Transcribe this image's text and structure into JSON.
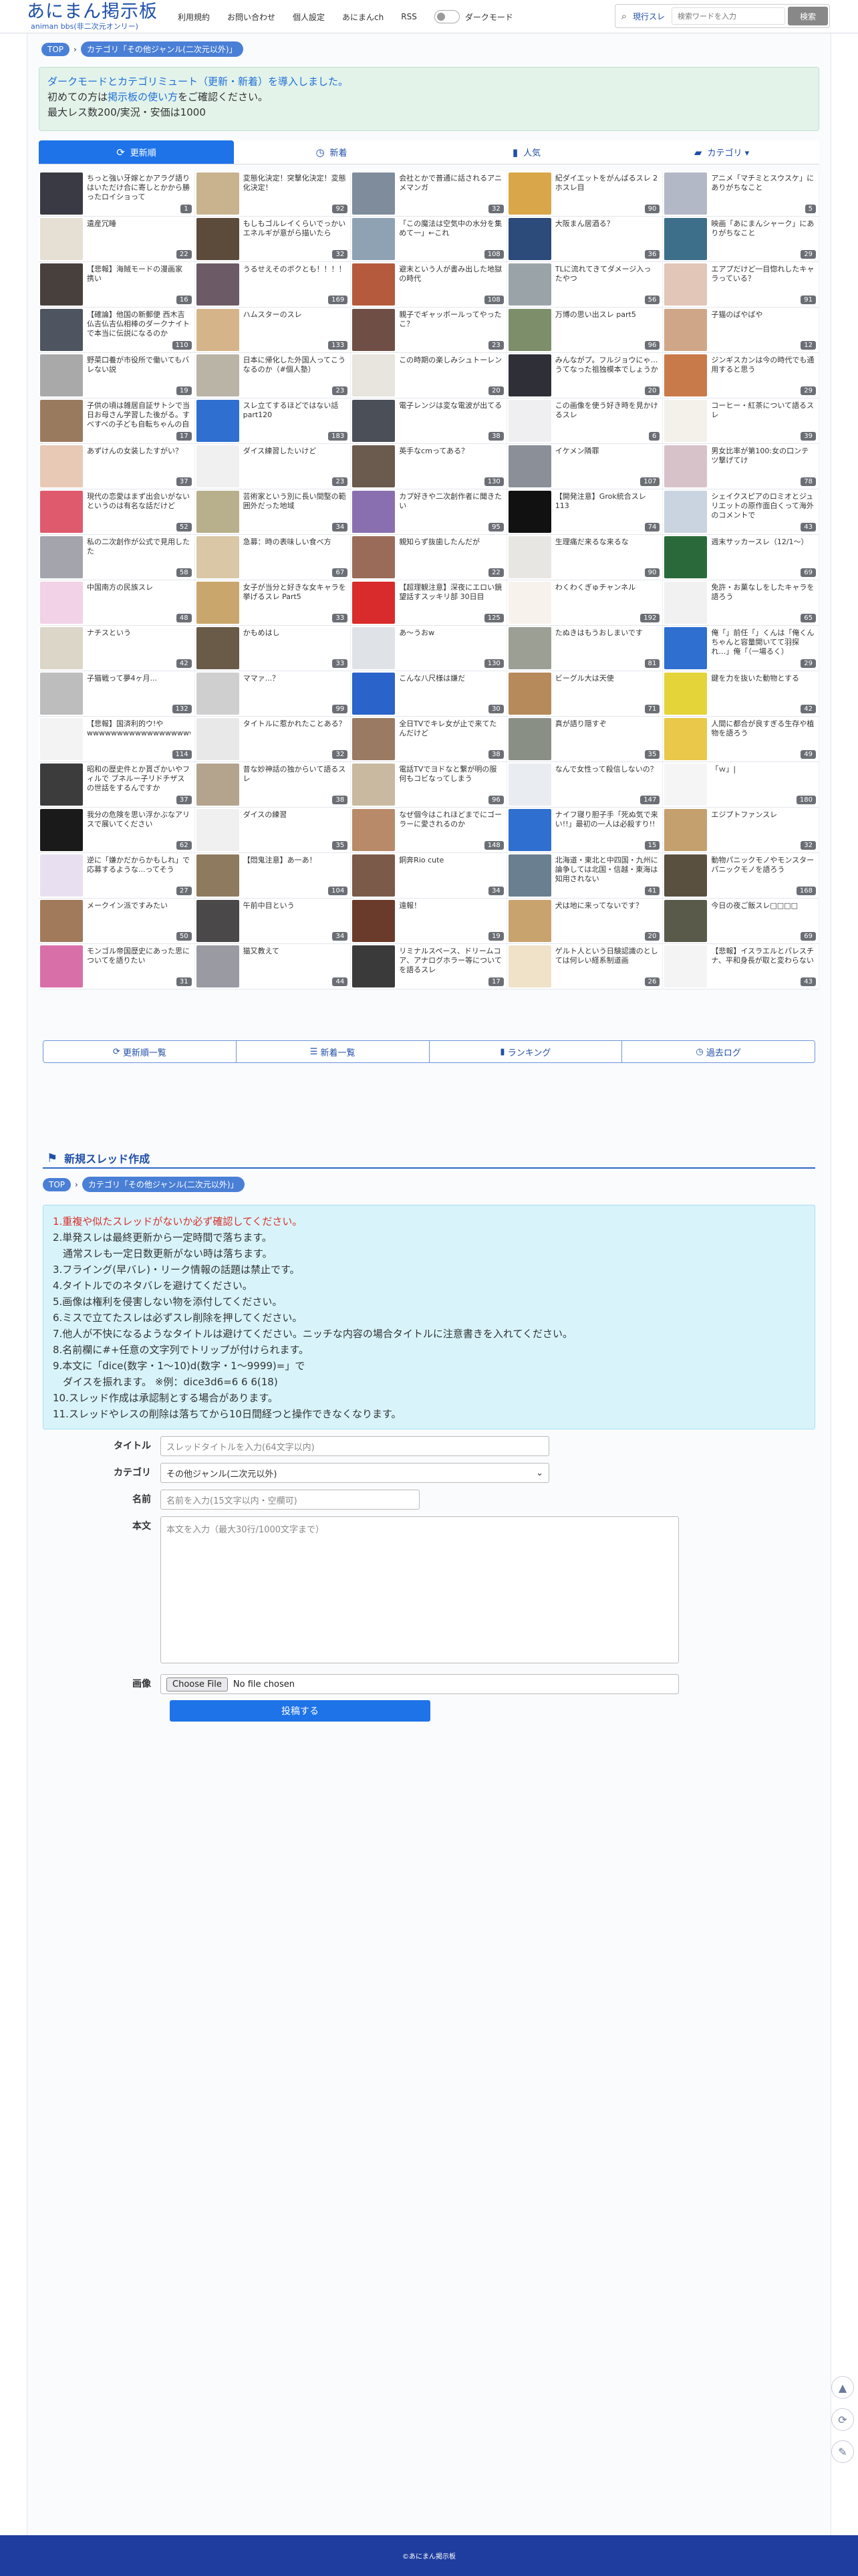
{
  "header": {
    "logo_main": "あにまん掲示板",
    "logo_sub": "animan bbs(非二次元オンリー)",
    "nav": [
      "利用規約",
      "お問い合わせ",
      "個人設定",
      "あにまんch",
      "RSS"
    ],
    "dark_mode_label": "ダークモード",
    "search_scope": "現行スレ",
    "search_placeholder": "検索ワードを入力",
    "search_button": "検索"
  },
  "breadcrumb": {
    "top": "TOP",
    "category": "カテゴリ「その他ジャンル(二次元以外)」"
  },
  "notice": {
    "line1": "ダークモードとカテゴリミュート（更新・新着）を導入しました。",
    "line2_pre": "初めての方は",
    "line2_link": "掲示板の使い方",
    "line2_post": "をご確認ください。",
    "line3": "最大レス数200/実況・安価は1000"
  },
  "tabs": [
    {
      "label": "更新順",
      "icon": "refresh-icon"
    },
    {
      "label": "新着",
      "icon": "clock-icon"
    },
    {
      "label": "人気",
      "icon": "bar-chart-icon"
    },
    {
      "label": "カテゴリ ▾",
      "icon": "folder-icon"
    }
  ],
  "threads": [
    {
      "title": "ちっと強い牙嫁とかアラグ語りはいただけ合に寄しとかから勝ったロイショって",
      "count": "1",
      "color": "#3a3a44"
    },
    {
      "title": "変態化決定！突撃化決定！変態化決定！",
      "count": "92",
      "color": "#c8b38e"
    },
    {
      "title": "会社とかで普通に話されるアニメマンガ",
      "count": "32",
      "color": "#7e8c9c"
    },
    {
      "title": "紀ダイエットをがんばるスレ 2ホスレ目",
      "count": "90",
      "color": "#d9a74a"
    },
    {
      "title": "アニメ「マチミとスウスケ」にありがちなこと",
      "count": "5",
      "color": "#b3b8c7"
    },
    {
      "title": "遺産冗睡",
      "count": "22",
      "color": "#e6e0d4"
    },
    {
      "title": "もしもゴルレイくらいでっかいエネルギが意がら描いたら",
      "count": "32",
      "color": "#5c4a3b"
    },
    {
      "title": "「この魔法は空気中の水分を集めて一」←これ",
      "count": "108",
      "color": "#8fa2b3"
    },
    {
      "title": "大阪まん居酒る？",
      "count": "36",
      "color": "#2c4a7a"
    },
    {
      "title": "映画「あにまんシャーク」にありがちなこと",
      "count": "29",
      "color": "#3d6f8a"
    },
    {
      "title": "【悲報】海賊モードの漫画家 携い",
      "count": "16",
      "color": "#48403c"
    },
    {
      "title": "うるせえそのボクとも！！！！",
      "count": "169",
      "color": "#6c5a66"
    },
    {
      "title": "避末という人が書み出した地獄の時代",
      "count": "108",
      "color": "#b55a3c"
    },
    {
      "title": "TLに流れてきてダメージ入ったやつ",
      "count": "56",
      "color": "#9aa4a8"
    },
    {
      "title": "エアプだけど一目惚れしたキャラっている？",
      "count": "91",
      "color": "#e2c6b8"
    },
    {
      "title": "【確論】他国の新郵便 西木吉仏吉仏吉仏相棒のダークナイトで本当に伝説になるのか",
      "count": "110",
      "color": "#4f5560"
    },
    {
      "title": "ハムスターのスレ",
      "count": "133",
      "color": "#d6b48a"
    },
    {
      "title": "親子でギャッボールってやったこ？",
      "count": "23",
      "color": "#6f4e46"
    },
    {
      "title": "万博の思い出スレ part5",
      "count": "96",
      "color": "#7c8f6a"
    },
    {
      "title": "子猫のばやばや",
      "count": "12",
      "color": "#cfa788"
    },
    {
      "title": "野菜口養が市役所で働いてもバレない説",
      "count": "19",
      "color": "#a9a9a9"
    },
    {
      "title": "日本に帰化した外国人ってこうなるのか（#個人塾）",
      "count": "23",
      "color": "#b9b4a6"
    },
    {
      "title": "この時期の楽しみシュトーレン",
      "count": "20",
      "color": "#e8e4de"
    },
    {
      "title": "みんながプ。フルジョウにゃ…うてなった祖独模本でしょうか",
      "count": "20",
      "color": "#2f2f38"
    },
    {
      "title": "ジンギスカンは今の時代でも通用すると思う",
      "count": "29",
      "color": "#c97a4a"
    },
    {
      "title": "子供の頃は雑居自証サトシで当日お母さん学習した後がる。すべすべの子ども自転ちゃんの自転で住所あるわ",
      "count": "17",
      "color": "#9a7a5e"
    },
    {
      "title": "スレ立てするほどではない話part120",
      "count": "183",
      "color": "#2f6fd0"
    },
    {
      "title": "電子レンジは変な電波が出てる",
      "count": "38",
      "color": "#4a4f58"
    },
    {
      "title": "この画像を使う好き時を見かけるスレ",
      "count": "6",
      "color": "#efeff2"
    },
    {
      "title": "コーヒー・紅茶について語るスレ",
      "count": "39",
      "color": "#f4f1ea"
    },
    {
      "title": "あずけんの女装したすがい？",
      "count": "37",
      "color": "#e8c9b6"
    },
    {
      "title": "ダイス練習したいけど",
      "count": "23",
      "color": "#f0f0f0"
    },
    {
      "title": "英手なcmってある？",
      "count": "130",
      "color": "#6b5a4e"
    },
    {
      "title": "イケメン隣罪",
      "count": "107",
      "color": "#8a8f98"
    },
    {
      "title": "男女比率が第100:女の口ンテツ撃げてけ",
      "count": "78",
      "color": "#d8c2c9"
    },
    {
      "title": "現代の恋愛はまず出会いがないというのは有名な話だけど",
      "count": "52",
      "color": "#e05a6e"
    },
    {
      "title": "芸術家という別に長い間堅の範囲外だった地域",
      "count": "34",
      "color": "#b8b08c"
    },
    {
      "title": "カプ好きや二次創作者に聞きたい",
      "count": "95",
      "color": "#8a6fb0"
    },
    {
      "title": "【開発注意】Grok統合スレ113",
      "count": "74",
      "color": "#111111"
    },
    {
      "title": "シェイクスピアのロミオとジュリエットの原作面白くって海外のコメントで",
      "count": "43",
      "color": "#c9d4e0"
    },
    {
      "title": "私の二次創作が公式で見用したた",
      "count": "58",
      "color": "#a4a4ac"
    },
    {
      "title": "急募：時の表味しい食べ方",
      "count": "67",
      "color": "#d9c7a6"
    },
    {
      "title": "親知らず抜歯したんだが",
      "count": "22",
      "color": "#9b6b5a"
    },
    {
      "title": "生理痛だ来るな来るな",
      "count": "90",
      "color": "#e8e6e2"
    },
    {
      "title": "週末サッカースレ（12/1〜）",
      "count": "69",
      "color": "#2a6a3a"
    },
    {
      "title": "中国南方の民族スレ",
      "count": "48",
      "color": "#f2d2e6"
    },
    {
      "title": "女子が当分と好きな女キャラを挙げるスレ Part5",
      "count": "33",
      "color": "#c9a66b"
    },
    {
      "title": "【超理観注意】深夜にエロい鏡望話すスッキリ部 30日目",
      "count": "125",
      "color": "#d92b2b"
    },
    {
      "title": "わくわくぎゅチャンネル",
      "count": "192",
      "color": "#f7f3ec"
    },
    {
      "title": "免許・お菓なしをしたキャラを語ろう",
      "count": "65",
      "color": "#f1f1f1"
    },
    {
      "title": "ナチスという",
      "count": "42",
      "color": "#dcd6c8"
    },
    {
      "title": "かもめはし",
      "count": "33",
      "color": "#6a5a48"
    },
    {
      "title": "あ〜うおw",
      "count": "130",
      "color": "#dfe3e8"
    },
    {
      "title": "たぬきはもうおしまいです",
      "count": "81",
      "color": "#9c9f94"
    },
    {
      "title": "俺「」前任「」くんは「俺くんちゃんと容量開いてて羽探れ…」俺「（一場るく）",
      "count": "29",
      "color": "#2e6fd0"
    },
    {
      "title": "子猫戦って夢4ヶ月...",
      "count": "132",
      "color": "#bdbdbd"
    },
    {
      "title": "ママァ...？",
      "count": "99",
      "color": "#cfcfcf"
    },
    {
      "title": "こんな八尺様は嫌だ",
      "count": "30",
      "color": "#2a63c9"
    },
    {
      "title": "ビーグル大は天使",
      "count": "71",
      "color": "#b68a5a"
    },
    {
      "title": "鍵を力を抜いた動物とする",
      "count": "42",
      "color": "#e4d43a"
    },
    {
      "title": "【悲報】国済利的ウ!やwwwwwwwwwwwwwwwwwwwwwwwwwwwwwwwwwwww",
      "count": "114",
      "color": "#f3f3f3"
    },
    {
      "title": "タイトルに惹かれたことある？",
      "count": "32",
      "color": "#e8e8e8"
    },
    {
      "title": "全日TVでキレ女が止で来てたんだけど",
      "count": "38",
      "color": "#9a7a62"
    },
    {
      "title": "真が語り隠すぞ",
      "count": "35",
      "color": "#8a8f85"
    },
    {
      "title": "人間に都合が良すぎる生存や植物を語ろう",
      "count": "49",
      "color": "#e9c84a"
    },
    {
      "title": "昭和の歴史件とか貰ざかいやフィルで ブネルー子リドチザスの世話をするんですか",
      "count": "37",
      "color": "#3c3c3c"
    },
    {
      "title": "昔な妙神話の独からいて語るスレ",
      "count": "38",
      "color": "#b4a48e"
    },
    {
      "title": "電話TVでヨドなと繋が明の服何もコビなってしまう",
      "count": "96",
      "color": "#c9b9a0"
    },
    {
      "title": "なんで女性って殺信しないの？",
      "count": "147",
      "color": "#e9ecf0"
    },
    {
      "title": "「ｗ」|",
      "count": "180",
      "color": "#f5f5f5"
    },
    {
      "title": "我分の危険を思い浮かぶなアリスで展いてください",
      "count": "62",
      "color": "#1a1a1a"
    },
    {
      "title": "ダイスの練習",
      "count": "35",
      "color": "#f0f0f0"
    },
    {
      "title": "なぜ個今はこれほどまでにゴーラーに愛されるのか",
      "count": "148",
      "color": "#b98a6a"
    },
    {
      "title": "ナイフ寝り胆子手「死ぬ気で来い!!」最初の一人は必殺すり!!",
      "count": "15",
      "color": "#2f6fd0"
    },
    {
      "title": "エジプトファンスレ",
      "count": "32",
      "color": "#c4a06e"
    },
    {
      "title": "逆に「嫌かだからかもしれ」で応募するような...ってそう",
      "count": "27",
      "color": "#e8e0f0"
    },
    {
      "title": "【悶鬼注意】あ一あ！",
      "count": "104",
      "color": "#8e7a5e"
    },
    {
      "title": "銅奔Rio cute",
      "count": "34",
      "color": "#7b5a4a"
    },
    {
      "title": "北海道・東北と中四国・九州に論争しては北国・信越・東海は知用されない",
      "count": "41",
      "color": "#6a7f8f"
    },
    {
      "title": "動物パニックモノやモンスターパニックモノを語ろう",
      "count": "168",
      "color": "#5a5040"
    },
    {
      "title": "メークイン派ですみたい",
      "count": "50",
      "color": "#a07a5a"
    },
    {
      "title": "午前中目という",
      "count": "34",
      "color": "#4a4848"
    },
    {
      "title": "遠報！",
      "count": "19",
      "color": "#6a3a2a"
    },
    {
      "title": "犬は地に来ってないです？",
      "count": "20",
      "color": "#c9a36e"
    },
    {
      "title": "今日の夜ご飯スレ□□□□",
      "count": "69",
      "color": "#5a5a4a"
    },
    {
      "title": "モンゴル帝国歴史にあった思についてを語りたい",
      "count": "31",
      "color": "#d96fa8"
    },
    {
      "title": "猫又教えて",
      "count": "44",
      "color": "#9a9aa2"
    },
    {
      "title": "リミナルスペース、ドリームコア、アナログホラー等についてを語るスレ",
      "count": "17",
      "color": "#3a3a3a"
    },
    {
      "title": "ゲルト人という日験認識のとしては何レい経系制道画",
      "count": "26",
      "color": "#efe2c8"
    },
    {
      "title": "【悲報】イスラエルとパレスチナ、平和身長が取と変わらない",
      "count": "43",
      "color": "#f4f4f4"
    }
  ],
  "bottom_nav": [
    "更新順一覧",
    "新着一覧",
    "ランキング",
    "過去ログ"
  ],
  "new_thread": {
    "heading": "新規スレッド作成",
    "rules": [
      "1.重複や似たスレッドがないか必ず確認してください。",
      "2.単発スレは最終更新から一定時間で落ちます。",
      "　通常スレも一定日数更新がない時は落ちます。",
      "3.フライング(早バレ)・リーク情報の話題は禁止です。",
      "4.タイトルでのネタバレを避けてください。",
      "5.画像は権利を侵害しない物を添付してください。",
      "6.ミスで立てたスレは必ずスレ削除を押してください。",
      "7.他人が不快になるようなタイトルは避けてください。ニッチな内容の場合タイトルに注意書きを入れてください。",
      "8.名前欄に#+任意の文字列でトリップが付けられます。",
      "9.本文に「dice(数字・1〜10)d(数字・1〜9999)=」で",
      "　ダイスを振れます。 ※例：dice3d6=6 6 6(18)",
      "10.スレッド作成は承認制とする場合があります。",
      "11.スレッドやレスの削除は落ちてから10日間経つと操作できなくなります。"
    ],
    "title_label": "タイトル",
    "title_placeholder": "スレッドタイトルを入力(64文字以内)",
    "category_label": "カテゴリ",
    "category_value": "その他ジャンル(二次元以外)",
    "name_label": "名前",
    "name_placeholder": "名前を入力(15文字以内・空欄可)",
    "body_label": "本文",
    "body_placeholder": "本文を入力（最大30行/1000文字まで）",
    "image_label": "画像",
    "file_button": "Choose File",
    "file_status": "No file chosen",
    "submit": "投稿する"
  },
  "footer": "©あにまん掲示板"
}
